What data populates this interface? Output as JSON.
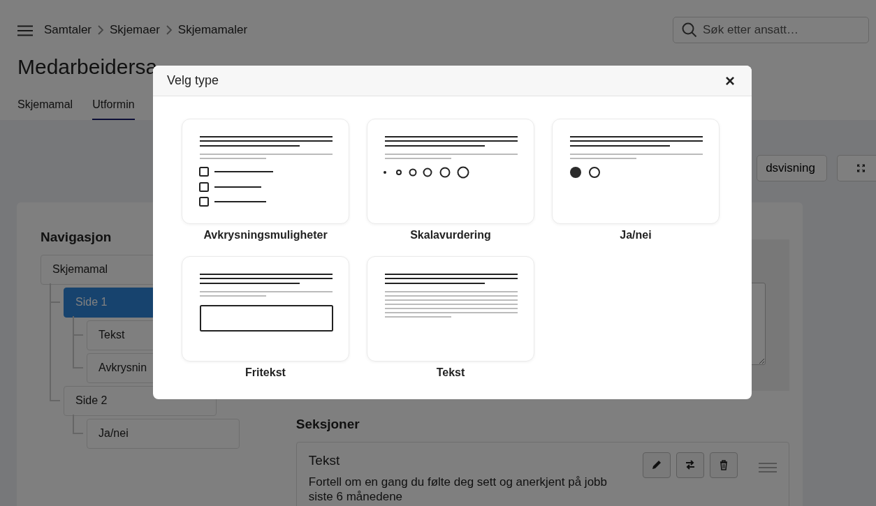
{
  "breadcrumbs": [
    "Samtaler",
    "Skjemaer",
    "Skjemamaler"
  ],
  "search": {
    "placeholder": "Søk etter ansatt…"
  },
  "title": "Medarbeidersa",
  "tabs": [
    {
      "label": "Skjemamal",
      "selected": false
    },
    {
      "label": "Utformin",
      "selected": true
    }
  ],
  "toolbar": {
    "preview_button": "dsvisning"
  },
  "navigation": {
    "heading": "Navigasjon",
    "tree": [
      {
        "label": "Skjemamal",
        "selected": false,
        "children": [
          {
            "label": "Side 1",
            "selected": true,
            "children": [
              {
                "label": "Tekst",
                "selected": false
              },
              {
                "label": "Avkrysnin",
                "selected": false
              }
            ]
          },
          {
            "label": "Side 2",
            "selected": false,
            "children": [
              {
                "label": "Ja/nei",
                "selected": false
              }
            ]
          }
        ]
      }
    ]
  },
  "sections": {
    "heading": "Seksjoner",
    "items": [
      {
        "title": "Tekst",
        "description": "Fortell om en gang du følte deg sett og anerkjent på jobb siste 6 månedene"
      }
    ]
  },
  "modal": {
    "title": "Velg type",
    "close": "×",
    "options": [
      {
        "label": "Avkrysningsmuligheter",
        "kind": "checkbox"
      },
      {
        "label": "Skalavurdering",
        "kind": "scale"
      },
      {
        "label": "Ja/nei",
        "kind": "yesno"
      },
      {
        "label": "Fritekst",
        "kind": "freetext"
      },
      {
        "label": "Tekst",
        "kind": "text"
      }
    ]
  }
}
